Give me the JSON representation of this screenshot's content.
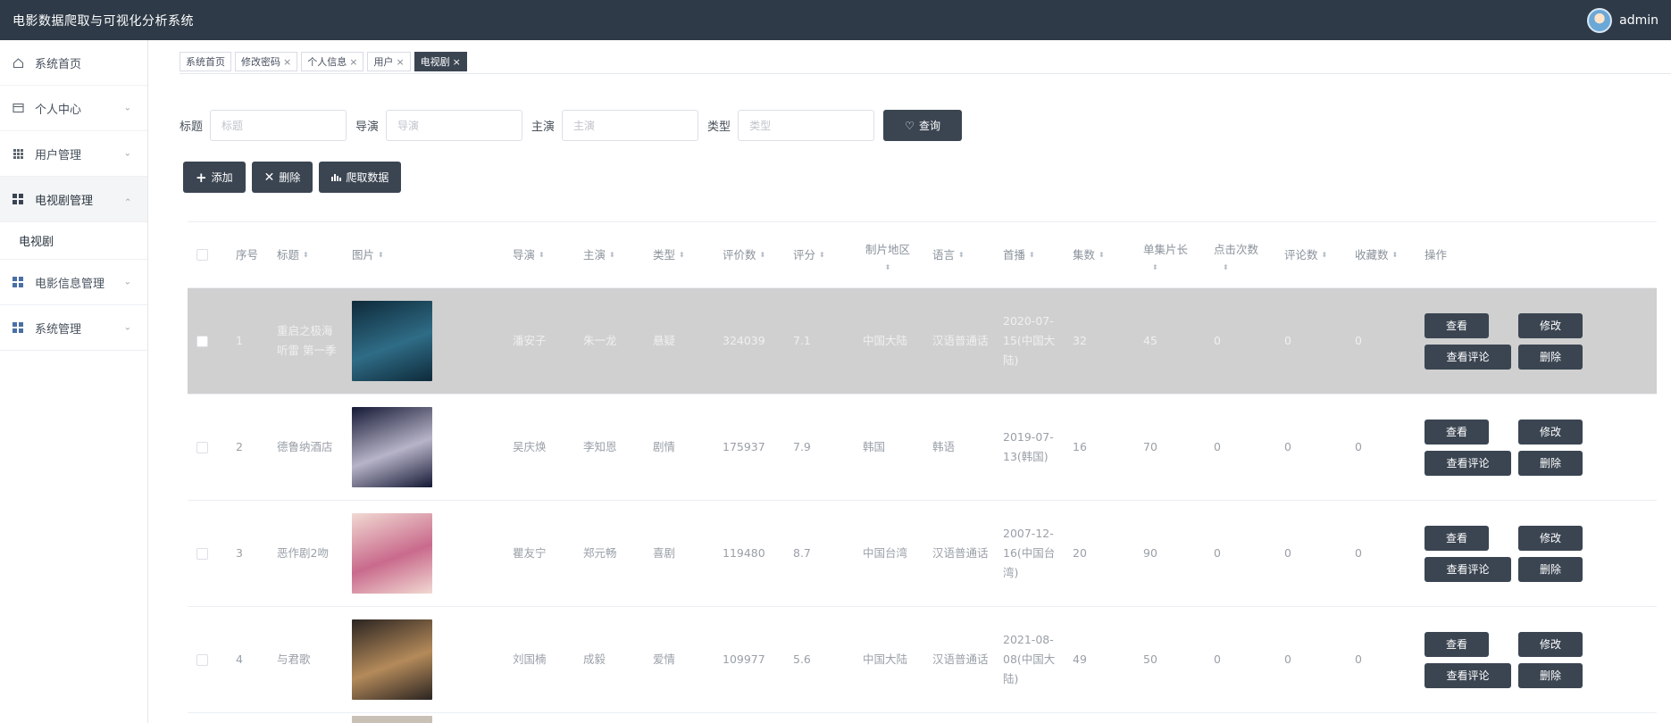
{
  "header": {
    "title": "电影数据爬取与可视化分析系统",
    "username": "admin"
  },
  "sidebar": {
    "items": [
      {
        "label": "系统首页",
        "icon": "home-icon"
      },
      {
        "label": "个人中心",
        "icon": "card-icon",
        "expandable": true
      },
      {
        "label": "用户管理",
        "icon": "grid-icon",
        "expandable": true
      },
      {
        "label": "电视剧管理",
        "icon": "grid-icon",
        "expandable": true,
        "open": true
      },
      {
        "label": "电视剧",
        "sub": true
      },
      {
        "label": "电影信息管理",
        "icon": "grid-icon",
        "expandable": true
      },
      {
        "label": "系统管理",
        "icon": "grid-icon",
        "expandable": true
      }
    ]
  },
  "tabs": [
    {
      "label": "系统首页",
      "closable": false
    },
    {
      "label": "修改密码",
      "closable": true
    },
    {
      "label": "个人信息",
      "closable": true
    },
    {
      "label": "用户",
      "closable": true
    },
    {
      "label": "电视剧",
      "closable": true,
      "active": true
    }
  ],
  "search": {
    "fields": [
      {
        "label": "标题",
        "placeholder": "标题"
      },
      {
        "label": "导演",
        "placeholder": "导演"
      },
      {
        "label": "主演",
        "placeholder": "主演"
      },
      {
        "label": "类型",
        "placeholder": "类型"
      }
    ],
    "query_label": "查询"
  },
  "actions": {
    "add": "添加",
    "delete": "删除",
    "crawl": "爬取数据"
  },
  "table": {
    "headers": {
      "index": "序号",
      "title": "标题",
      "image": "图片",
      "director": "导演",
      "actor": "主演",
      "genre": "类型",
      "rating_count": "评价数",
      "score": "评分",
      "region": "制片地区",
      "language": "语言",
      "premiere": "首播",
      "episodes": "集数",
      "episode_length": "单集片长",
      "clicks": "点击次数",
      "comments": "评论数",
      "favorites": "收藏数",
      "ops": "操作"
    },
    "rows": [
      {
        "index": "1",
        "title": "重启之极海听雷 第一季",
        "director": "潘安子",
        "actor": "朱一龙",
        "genre": "悬疑",
        "rating_count": "324039",
        "score": "7.1",
        "region": "中国大陆",
        "language": "汉语普通话",
        "premiere": "2020-07-15(中国大陆)",
        "episodes": "32",
        "episode_length": "45",
        "clicks": "0",
        "comments": "0",
        "favorites": "0",
        "poster_colors": [
          "#0e2a3a",
          "#2f6c86"
        ]
      },
      {
        "index": "2",
        "title": "德鲁纳酒店",
        "director": "吴庆焕",
        "actor": "李知恩",
        "genre": "剧情",
        "rating_count": "175937",
        "score": "7.9",
        "region": "韩国",
        "language": "韩语",
        "premiere": "2019-07-13(韩国)",
        "episodes": "16",
        "episode_length": "70",
        "clicks": "0",
        "comments": "0",
        "favorites": "0",
        "poster_colors": [
          "#151935",
          "#b7b4c8"
        ]
      },
      {
        "index": "3",
        "title": "恶作剧2吻",
        "director": "瞿友宁",
        "actor": "郑元畅",
        "genre": "喜剧",
        "rating_count": "119480",
        "score": "8.7",
        "region": "中国台湾",
        "language": "汉语普通话",
        "premiere": "2007-12-16(中国台湾)",
        "episodes": "20",
        "episode_length": "90",
        "clicks": "0",
        "comments": "0",
        "favorites": "0",
        "poster_colors": [
          "#f1d9d2",
          "#c96a8c"
        ]
      },
      {
        "index": "4",
        "title": "与君歌",
        "director": "刘国楠",
        "actor": "成毅",
        "genre": "爱情",
        "rating_count": "109977",
        "score": "5.6",
        "region": "中国大陆",
        "language": "汉语普通话",
        "premiere": "2021-08-08(中国大陆)",
        "episodes": "49",
        "episode_length": "50",
        "clicks": "0",
        "comments": "0",
        "favorites": "0",
        "poster_colors": [
          "#2b2421",
          "#b48a5a"
        ]
      }
    ],
    "row_buttons": {
      "view": "查看",
      "edit": "修改",
      "view_comments": "查看评论",
      "delete": "删除"
    }
  }
}
